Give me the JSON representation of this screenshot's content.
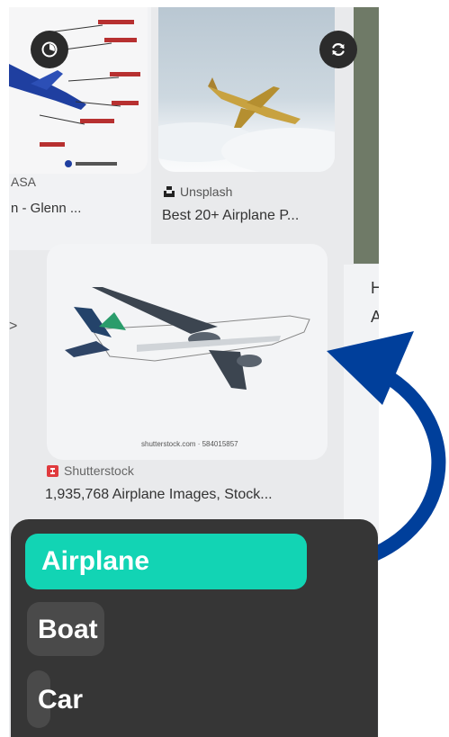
{
  "results": {
    "left": {
      "source": "ASA",
      "title": "n - Glenn ..."
    },
    "top": {
      "source": "Unsplash",
      "title": "Best 20+ Airplane P..."
    },
    "main": {
      "source": "Shutterstock",
      "title": "1,935,768 Airplane Images, Stock...",
      "watermark": "shutterstock.com · 584015857"
    },
    "right_letters": [
      "H",
      "A"
    ],
    "left_chevron": ">"
  },
  "controls": {
    "left_icon": "lens-icon",
    "right_icon": "refresh-icon"
  },
  "detections": [
    "Airplane",
    "Boat",
    "Car"
  ],
  "colors": {
    "accent": "#12d4b4",
    "panel": "#363636",
    "arrow": "#003f9b",
    "shutterstock": "#e03a3e"
  }
}
